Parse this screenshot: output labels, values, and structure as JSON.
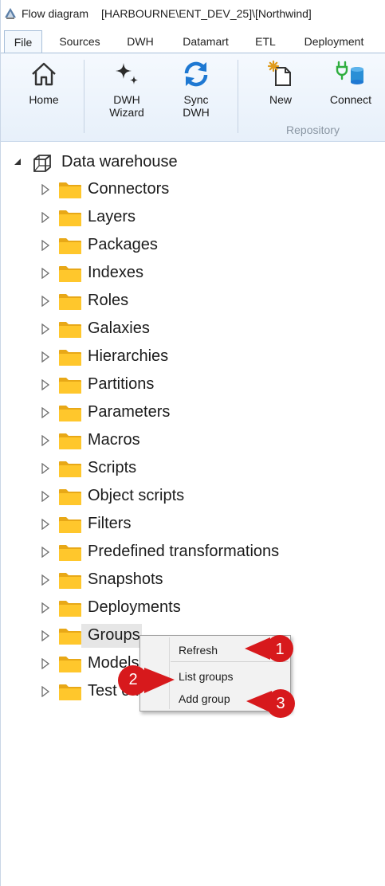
{
  "titlebar": {
    "app_name": "Flow diagram",
    "connection": "[HARBOURNE\\ENT_DEV_25]\\[Northwind]"
  },
  "tabs": [
    {
      "label": "File",
      "active": true
    },
    {
      "label": "Sources",
      "active": false
    },
    {
      "label": "DWH",
      "active": false
    },
    {
      "label": "Datamart",
      "active": false
    },
    {
      "label": "ETL",
      "active": false
    },
    {
      "label": "Deployment",
      "active": false
    }
  ],
  "ribbon": {
    "home": {
      "label": "Home",
      "icon": "home-icon"
    },
    "dwh_wizard": {
      "line1": "DWH",
      "line2": "Wizard",
      "icon": "sparkle-icon"
    },
    "sync_dwh": {
      "line1": "Sync",
      "line2": "DWH",
      "icon": "sync-icon"
    },
    "new": {
      "label": "New",
      "icon": "new-document-icon"
    },
    "connect": {
      "label": "Connect",
      "icon": "plug-database-icon"
    },
    "group_label": "Repository"
  },
  "tree": {
    "root": {
      "label": "Data warehouse",
      "icon": "cube-icon",
      "expanded": true
    },
    "items": [
      {
        "label": "Connectors"
      },
      {
        "label": "Layers"
      },
      {
        "label": "Packages"
      },
      {
        "label": "Indexes"
      },
      {
        "label": "Roles"
      },
      {
        "label": "Galaxies"
      },
      {
        "label": "Hierarchies"
      },
      {
        "label": "Partitions"
      },
      {
        "label": "Parameters"
      },
      {
        "label": "Macros"
      },
      {
        "label": "Scripts"
      },
      {
        "label": "Object scripts"
      },
      {
        "label": "Filters"
      },
      {
        "label": "Predefined transformations"
      },
      {
        "label": "Snapshots"
      },
      {
        "label": "Deployments"
      },
      {
        "label": "Groups",
        "selected": true
      },
      {
        "label": "Models"
      },
      {
        "label": "Test cases"
      }
    ]
  },
  "context_menu": {
    "items": [
      "Refresh",
      "List groups",
      "Add group"
    ]
  },
  "callouts": [
    "1",
    "2",
    "3"
  ],
  "colors": {
    "accent": "#1e78d2",
    "folder": "#ffc72c",
    "callout": "#d7191c",
    "ribbon_bg": "#e9f1fb"
  }
}
